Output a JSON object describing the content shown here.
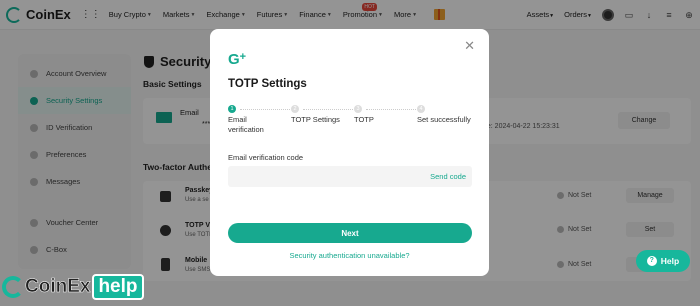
{
  "nav": {
    "brand": "CoinEx",
    "menu": [
      "Buy Crypto",
      "Markets",
      "Exchange",
      "Futures",
      "Finance",
      "Promotion",
      "More"
    ],
    "hot_badge": "HOT",
    "right": [
      "Assets",
      "Orders"
    ]
  },
  "sidebar": {
    "items": [
      "Account Overview",
      "Security Settings",
      "ID Verification",
      "Preferences",
      "Messages",
      "Voucher Center",
      "C-Box"
    ],
    "active": "Security Settings"
  },
  "page": {
    "title": "Security",
    "basic_heading": "Basic Settings",
    "email_label": "Email",
    "email_masked": "****",
    "change_date": "ge: 2024-04-22 15:23:31",
    "change_button": "Change",
    "twofa_heading": "Two-factor Authe",
    "rows": [
      {
        "title": "Passkey",
        "sub": "Use a se",
        "status": "Not Set",
        "action": "Manage"
      },
      {
        "title": "TOTP V",
        "sub": "Use TOTP",
        "status": "Not Set",
        "action": "Set"
      },
      {
        "title": "Mobile",
        "sub": "Use SMS",
        "status": "Not Set",
        "action": "Set"
      }
    ]
  },
  "modal": {
    "logo": "G",
    "title": "TOTP Settings",
    "steps": [
      {
        "num": "1",
        "label": "Email verification"
      },
      {
        "num": "2",
        "label": "TOTP Settings"
      },
      {
        "num": "3",
        "label": "TOTP"
      },
      {
        "num": "4",
        "label": "Set successfully"
      }
    ],
    "active_step": 1,
    "code_label": "Email verification code",
    "code_placeholder": "",
    "send_code": "Send code",
    "next": "Next",
    "unavailable": "Security authentication unavailable?"
  },
  "watermark": {
    "brand": "CoinEx",
    "help": "help"
  },
  "help_button": "Help",
  "colors": {
    "accent": "#17a98f",
    "overlay": "rgba(0,0,0,0.42)"
  }
}
